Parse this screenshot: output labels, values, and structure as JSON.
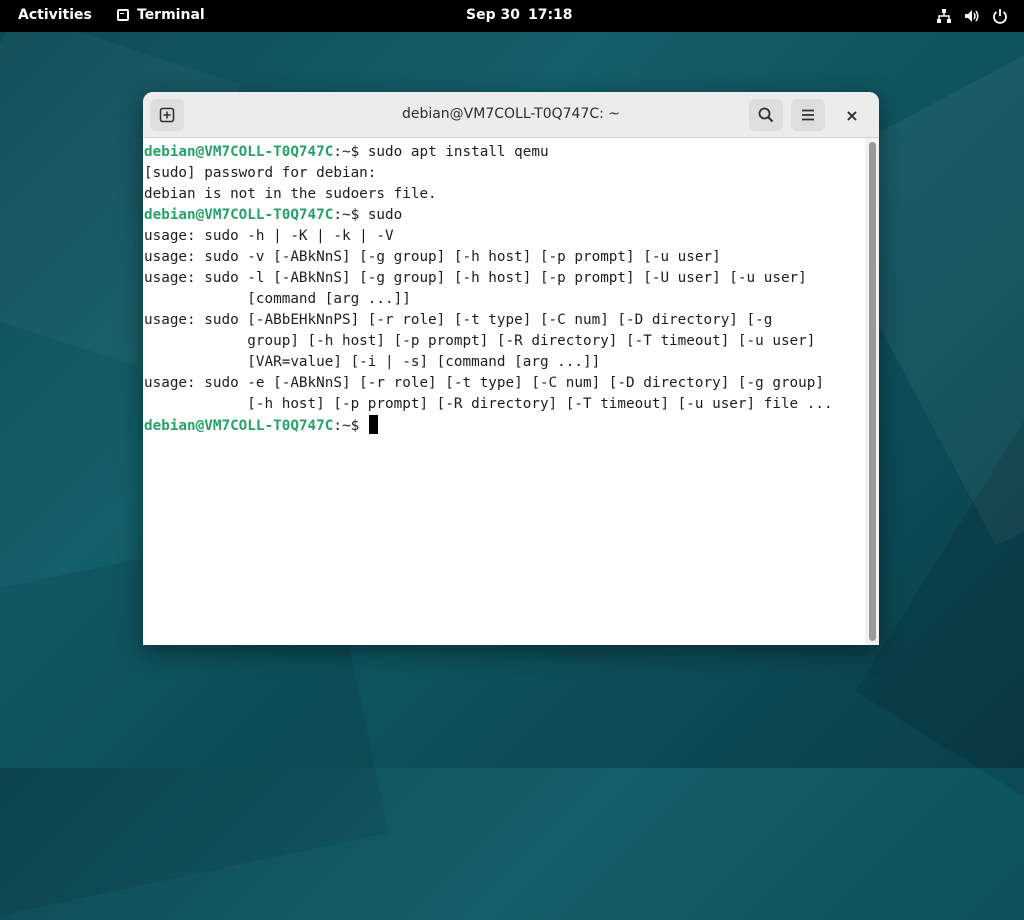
{
  "topbar": {
    "activities": "Activities",
    "app_name": "Terminal",
    "date": "Sep 30",
    "time": "17:18",
    "icons": [
      "network-icon",
      "volume-icon",
      "power-icon"
    ]
  },
  "window": {
    "title": "debian@VM7COLL-T0Q747C: ~",
    "close_glyph": "×",
    "buttons": [
      "new-tab-icon",
      "search-icon",
      "menu-icon"
    ]
  },
  "terminal": {
    "prompt_user": "debian@VM7COLL-T0Q747C",
    "prompt_path": ":~$ ",
    "line1_cmd": "sudo apt install qemu",
    "line2": "[sudo] password for debian:",
    "line3": "debian is not in the sudoers file.",
    "line4_cmd": "sudo",
    "line5": "usage: sudo -h | -K | -k | -V",
    "line6": "usage: sudo -v [-ABkNnS] [-g group] [-h host] [-p prompt] [-u user]",
    "line7": "usage: sudo -l [-ABkNnS] [-g group] [-h host] [-p prompt] [-U user] [-u user]",
    "line8": "            [command [arg ...]]",
    "line9": "usage: sudo [-ABbEHkNnPS] [-r role] [-t type] [-C num] [-D directory] [-g",
    "line10": "            group] [-h host] [-p prompt] [-R directory] [-T timeout] [-u user]",
    "line11": "            [VAR=value] [-i | -s] [command [arg ...]]",
    "line12": "usage: sudo -e [-ABkNnS] [-r role] [-t type] [-C num] [-D directory] [-g group]",
    "line13": "            [-h host] [-p prompt] [-R directory] [-T timeout] [-u user] file ..."
  },
  "colors": {
    "prompt": "#26a269",
    "topbar": "#000000",
    "desktop": "#135f6b"
  }
}
